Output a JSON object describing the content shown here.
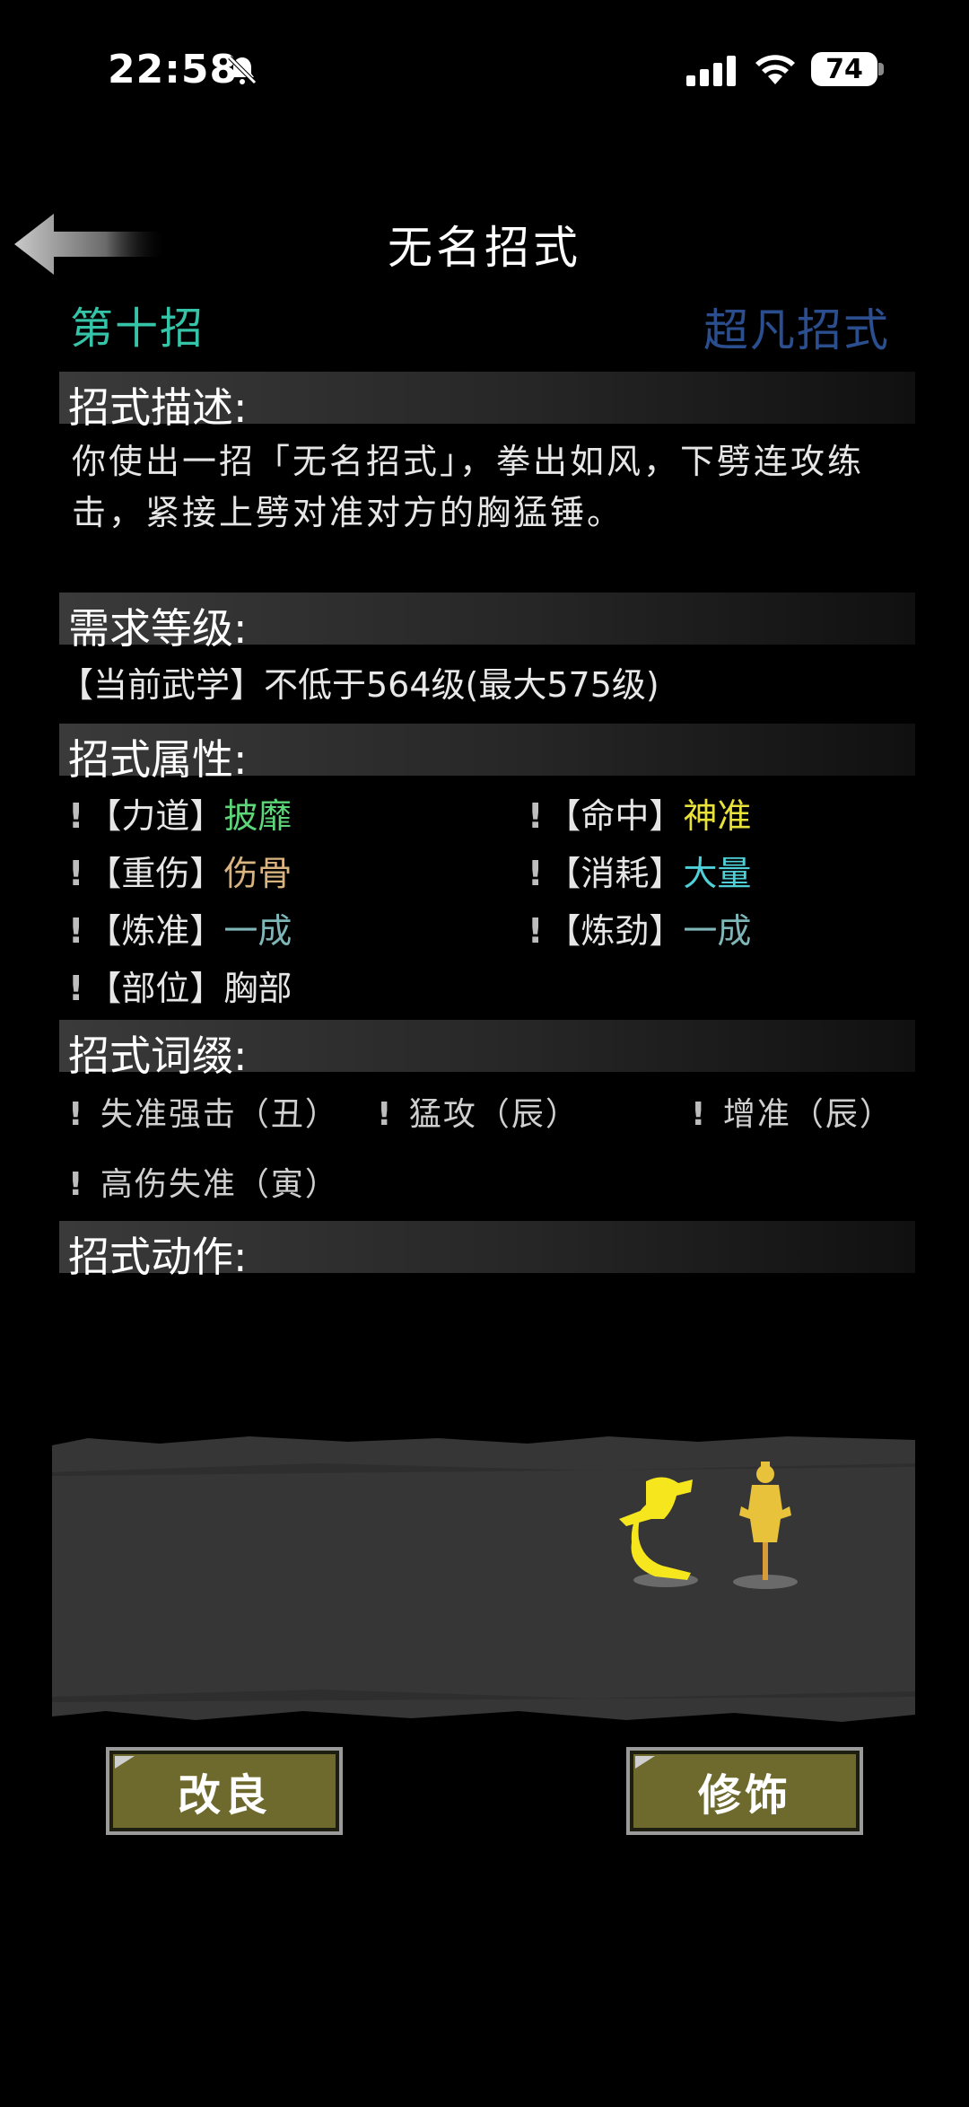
{
  "status": {
    "time": "22:58",
    "battery": "74"
  },
  "header": {
    "title": "无名招式",
    "index": "第十招",
    "tier": "超凡招式"
  },
  "sections": {
    "desc_title": "招式描述:",
    "desc_text": "你使出一招「无名招式」，拳出如风，下劈连攻练击，紧接上劈对准对方的胸猛锤。",
    "req_title": "需求等级:",
    "req_text": "【当前武学】不低于564级(最大575级)",
    "attr_title": "招式属性:",
    "suffix_title": "招式词缀:",
    "action_title": "招式动作:"
  },
  "attributes": [
    {
      "label": "【力道】",
      "value": "披靡",
      "color": "#5dd67a"
    },
    {
      "label": "【命中】",
      "value": "神准",
      "color": "#e8e23a"
    },
    {
      "label": "【重伤】",
      "value": "伤骨",
      "color": "#d9b380"
    },
    {
      "label": "【消耗】",
      "value": "大量",
      "color": "#4fd0d8"
    },
    {
      "label": "【炼准】",
      "value": "一成",
      "color": "#7fb6b8"
    },
    {
      "label": "【炼劲】",
      "value": "一成",
      "color": "#7fb6b8"
    },
    {
      "label": "【部位】",
      "value": "胸部",
      "color": "#e6e6e6"
    }
  ],
  "suffixes": [
    "失准强击（丑）",
    "猛攻（辰）",
    "增准（辰）",
    "高伤失准（寅）"
  ],
  "buttons": {
    "improve": "改良",
    "decorate": "修饰"
  }
}
